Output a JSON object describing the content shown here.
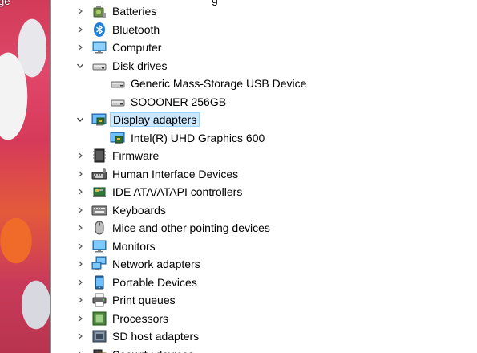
{
  "desktop": {
    "label": "ge"
  },
  "tree": {
    "top_cut_text": "g",
    "items": [
      {
        "label": "Batteries",
        "icon": "battery-icon",
        "expander": "collapsed",
        "level": 0
      },
      {
        "label": "Bluetooth",
        "icon": "bluetooth-icon",
        "expander": "collapsed",
        "level": 0
      },
      {
        "label": "Computer",
        "icon": "computer-icon",
        "expander": "collapsed",
        "level": 0
      },
      {
        "label": "Disk drives",
        "icon": "disk-drive-icon",
        "expander": "expanded",
        "level": 0
      },
      {
        "label": "Generic Mass-Storage USB Device",
        "icon": "disk-drive-icon",
        "expander": "none",
        "level": 1
      },
      {
        "label": "SOOONER  256GB",
        "icon": "disk-drive-icon",
        "expander": "none",
        "level": 1
      },
      {
        "label": "Display adapters",
        "icon": "display-adapter-icon",
        "expander": "expanded",
        "level": 0,
        "selected": true
      },
      {
        "label": "Intel(R) UHD Graphics 600",
        "icon": "display-adapter-icon",
        "expander": "none",
        "level": 1
      },
      {
        "label": "Firmware",
        "icon": "firmware-icon",
        "expander": "collapsed",
        "level": 0
      },
      {
        "label": "Human Interface Devices",
        "icon": "hid-icon",
        "expander": "collapsed",
        "level": 0
      },
      {
        "label": "IDE ATA/ATAPI controllers",
        "icon": "ide-controller-icon",
        "expander": "collapsed",
        "level": 0
      },
      {
        "label": "Keyboards",
        "icon": "keyboard-icon",
        "expander": "collapsed",
        "level": 0
      },
      {
        "label": "Mice and other pointing devices",
        "icon": "mouse-icon",
        "expander": "collapsed",
        "level": 0
      },
      {
        "label": "Monitors",
        "icon": "monitor-icon",
        "expander": "collapsed",
        "level": 0
      },
      {
        "label": "Network adapters",
        "icon": "network-adapter-icon",
        "expander": "collapsed",
        "level": 0
      },
      {
        "label": "Portable Devices",
        "icon": "portable-device-icon",
        "expander": "collapsed",
        "level": 0
      },
      {
        "label": "Print queues",
        "icon": "printer-icon",
        "expander": "collapsed",
        "level": 0
      },
      {
        "label": "Processors",
        "icon": "processor-icon",
        "expander": "collapsed",
        "level": 0
      },
      {
        "label": "SD host adapters",
        "icon": "sd-host-adapter-icon",
        "expander": "collapsed",
        "level": 0
      },
      {
        "label": "Security devices",
        "icon": "security-device-icon",
        "expander": "collapsed",
        "level": 0
      }
    ]
  },
  "colors": {
    "selection_bg": "#cce8ff",
    "selection_border": "#99d1ff",
    "chevron": "#5a5a5a"
  }
}
